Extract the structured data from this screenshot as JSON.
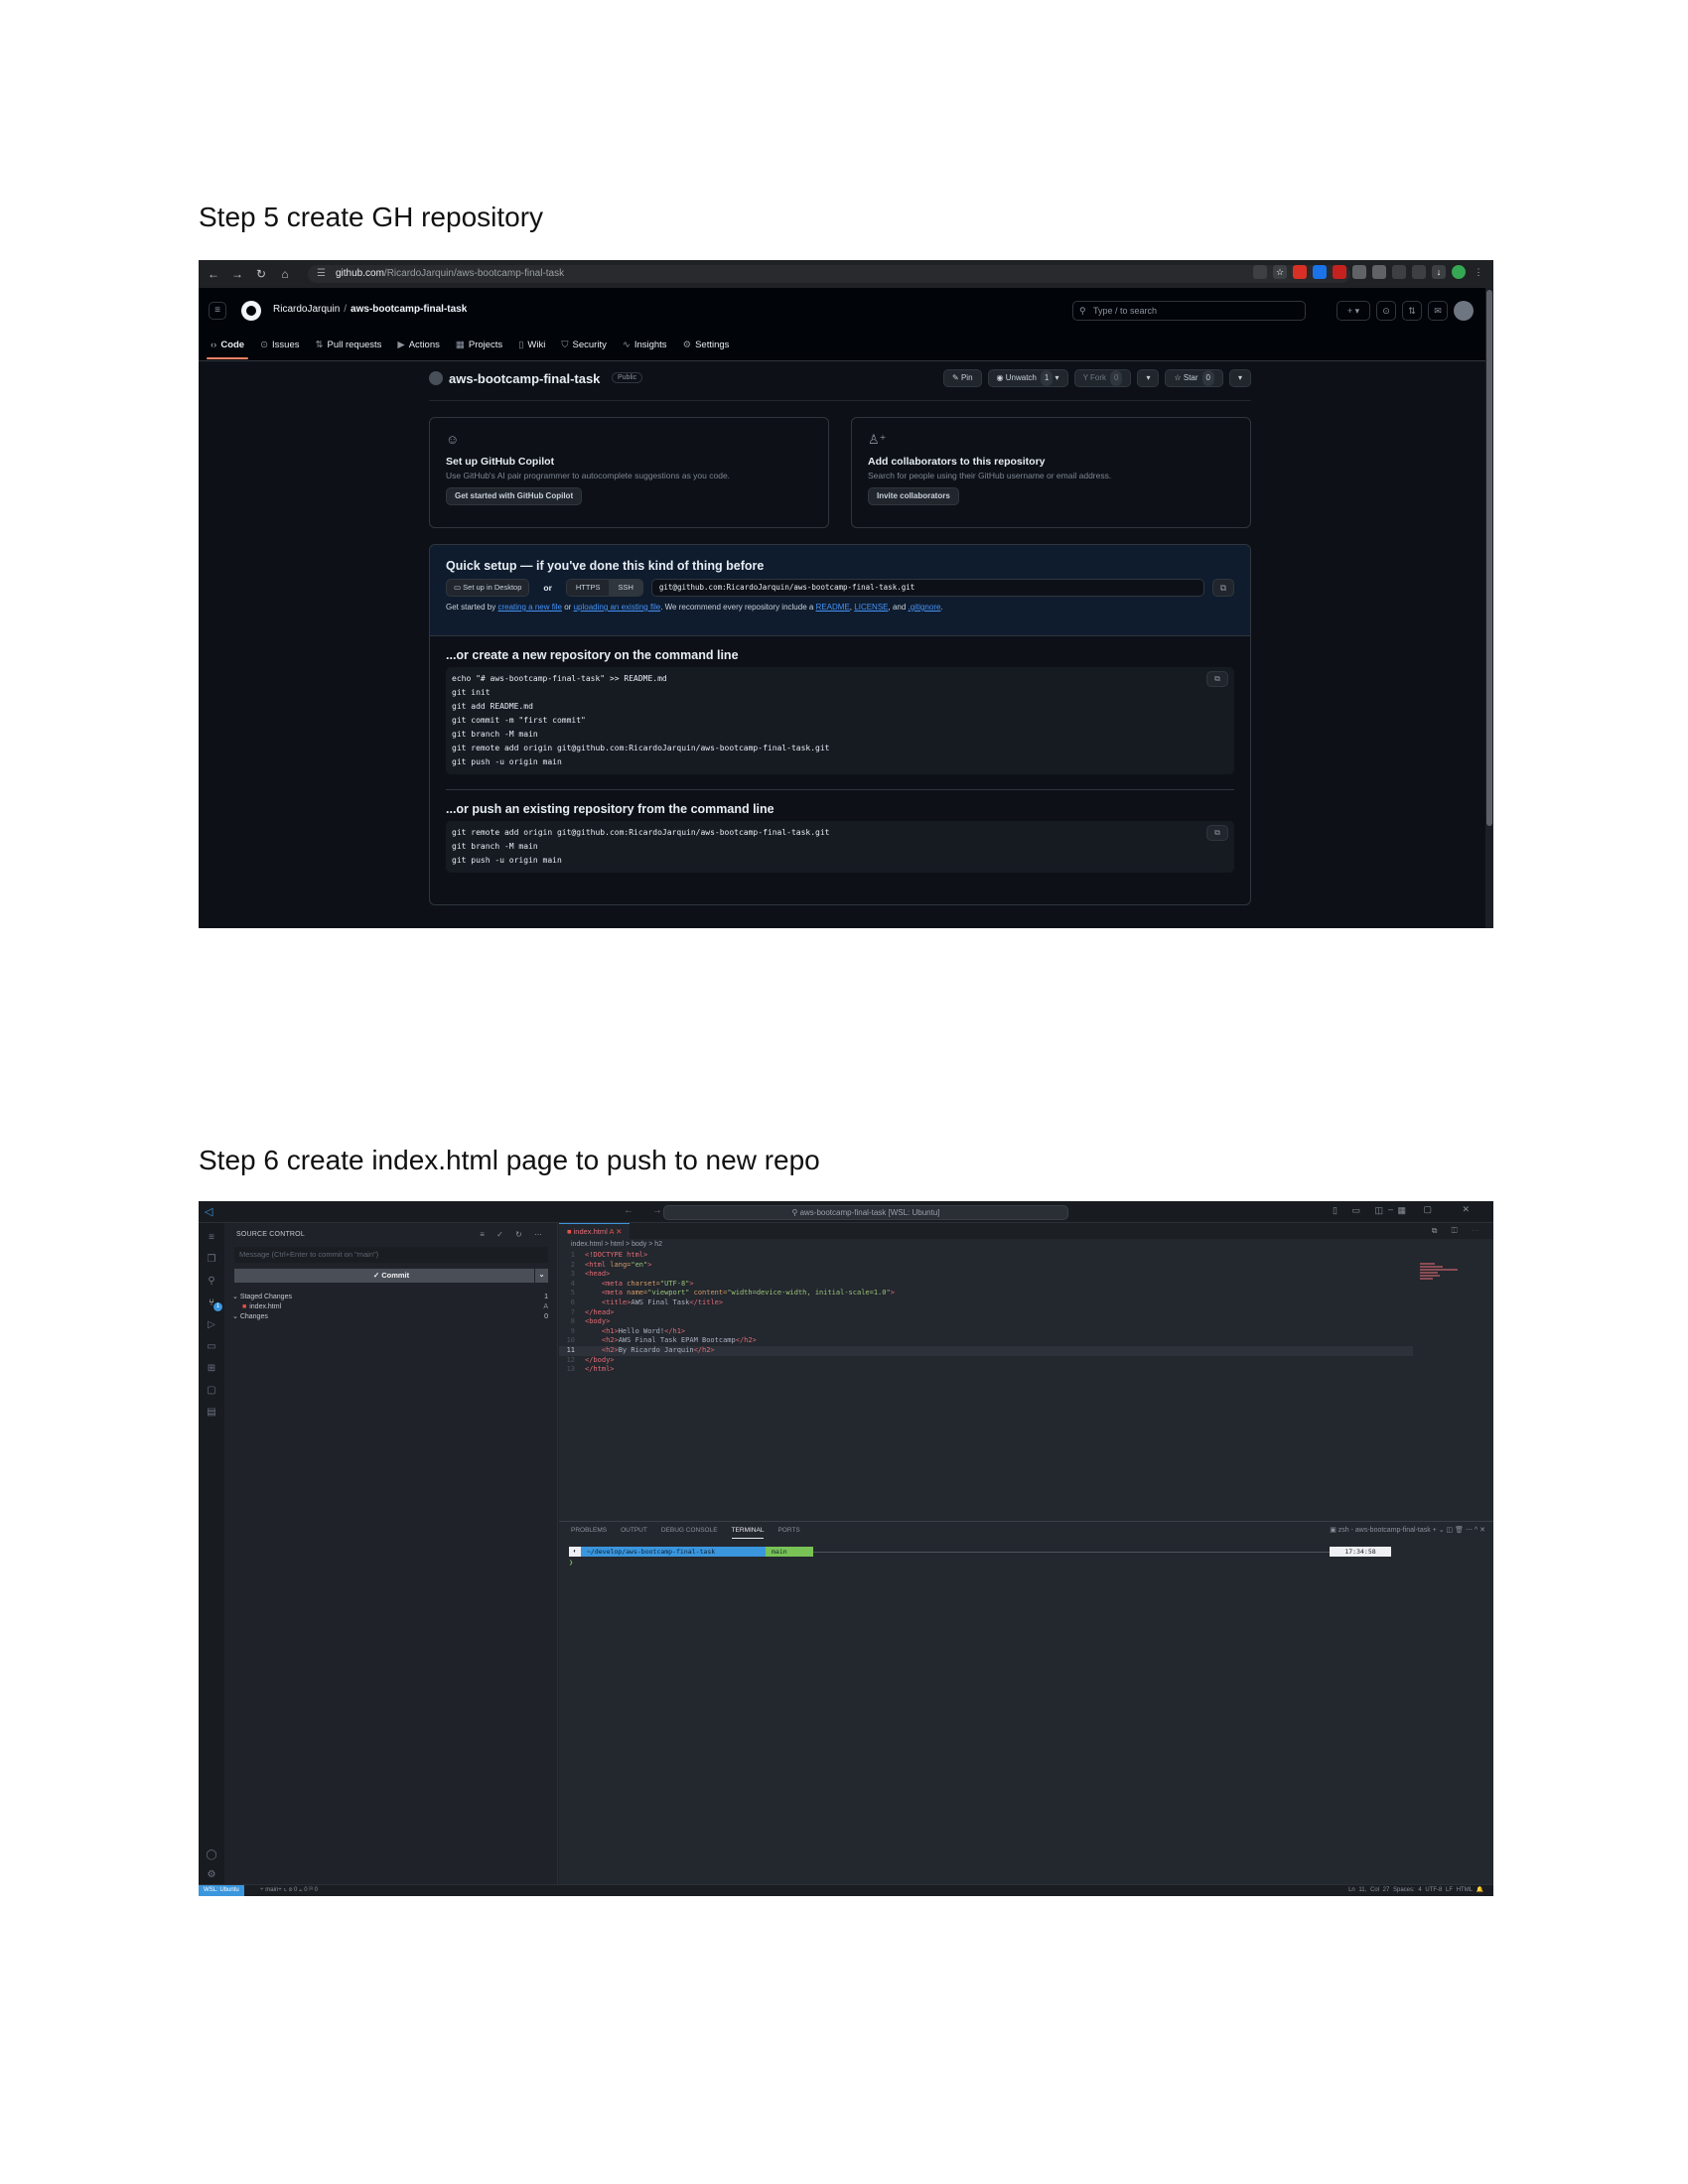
{
  "headings": {
    "step5": "Step 5 create GH repository",
    "step6": "Step 6 create index.html page to push to new repo"
  },
  "github": {
    "browser": {
      "url_host": "github.com",
      "url_path": "/RicardoJarquin/aws-bootcamp-final-task"
    },
    "header": {
      "owner": "RicardoJarquin",
      "separator": "/",
      "repo": "aws-bootcamp-final-task",
      "search_placeholder": "Type / to search"
    },
    "tabs": [
      {
        "label": "Code",
        "icon": "code-icon"
      },
      {
        "label": "Issues",
        "icon": "issue-icon"
      },
      {
        "label": "Pull requests",
        "icon": "pull-request-icon"
      },
      {
        "label": "Actions",
        "icon": "play-icon"
      },
      {
        "label": "Projects",
        "icon": "table-icon"
      },
      {
        "label": "Wiki",
        "icon": "book-icon"
      },
      {
        "label": "Security",
        "icon": "shield-icon"
      },
      {
        "label": "Insights",
        "icon": "graph-icon"
      },
      {
        "label": "Settings",
        "icon": "gear-icon"
      }
    ],
    "repo": {
      "name": "aws-bootcamp-final-task",
      "visibility": "Public",
      "pin": "Pin",
      "unwatch": "Unwatch",
      "unwatch_count": "1",
      "fork": "Fork",
      "fork_count": "0",
      "star": "Star",
      "star_count": "0"
    },
    "cards": {
      "copilot": {
        "title": "Set up GitHub Copilot",
        "desc": "Use GitHub's AI pair programmer to autocomplete suggestions as you code.",
        "button": "Get started with GitHub Copilot"
      },
      "collab": {
        "title": "Add collaborators to this repository",
        "desc": "Search for people using their GitHub username or email address.",
        "button": "Invite collaborators"
      }
    },
    "quick_setup": {
      "title": "Quick setup — if you've done this kind of thing before",
      "desktop": "Set up in Desktop",
      "or": "or",
      "https": "HTTPS",
      "ssh": "SSH",
      "clone_url": "git@github.com:RicardoJarquin/aws-bootcamp-final-task.git",
      "started_prefix": "Get started by",
      "link_new": "creating a new file",
      "or_word": "or",
      "link_upload": "uploading an existing file",
      "recommend": ". We recommend every repository include a",
      "link_readme": "README",
      "comma": ",",
      "link_license": "LICENSE",
      "and": ", and",
      "link_gitignore": ".gitignore",
      "period": "."
    },
    "new_repo": {
      "title": "...or create a new repository on the command line",
      "lines": [
        "echo \"# aws-bootcamp-final-task\" >> README.md",
        "git init",
        "git add README.md",
        "git commit -m \"first commit\"",
        "git branch -M main",
        "git remote add origin git@github.com:RicardoJarquin/aws-bootcamp-final-task.git",
        "git push -u origin main"
      ]
    },
    "push_existing": {
      "title": "...or push an existing repository from the command line",
      "lines": [
        "git remote add origin git@github.com:RicardoJarquin/aws-bootcamp-final-task.git",
        "git branch -M main",
        "git push -u origin main"
      ]
    }
  },
  "vscode": {
    "command_center": "aws-bootcamp-final-task [WSL: Ubuntu]",
    "sidebar": {
      "title": "SOURCE CONTROL",
      "message_placeholder": "Message (Ctrl+Enter to commit on \"main\")",
      "commit_label": "✓ Commit",
      "staged_label": "Staged Changes",
      "staged_count": "1",
      "staged_file": "index.html",
      "staged_file_status": "A",
      "changes_label": "Changes",
      "changes_count": "0",
      "badge": "1"
    },
    "editor": {
      "tab_name": "index.html",
      "tab_status": "A",
      "breadcrumb": "index.html > html > body > h2",
      "code": [
        {
          "n": "1",
          "parts": [
            [
              "tag",
              "<!DOCTYPE html>"
            ]
          ]
        },
        {
          "n": "2",
          "parts": [
            [
              "tag",
              "<html "
            ],
            [
              "attr",
              "lang="
            ],
            [
              "str",
              "\"en\""
            ],
            [
              "tag",
              ">"
            ]
          ]
        },
        {
          "n": "3",
          "parts": [
            [
              "tag",
              "<head>"
            ]
          ]
        },
        {
          "n": "4",
          "parts": [
            [
              "txt",
              "    "
            ],
            [
              "tag",
              "<meta "
            ],
            [
              "attr",
              "charset="
            ],
            [
              "str",
              "\"UTF-8\""
            ],
            [
              "tag",
              ">"
            ]
          ]
        },
        {
          "n": "5",
          "parts": [
            [
              "txt",
              "    "
            ],
            [
              "tag",
              "<meta "
            ],
            [
              "attr",
              "name="
            ],
            [
              "str",
              "\"viewport\""
            ],
            [
              "attr",
              " content="
            ],
            [
              "str",
              "\"width=device-width, initial-scale=1.0\""
            ],
            [
              "tag",
              ">"
            ]
          ]
        },
        {
          "n": "6",
          "parts": [
            [
              "txt",
              "    "
            ],
            [
              "tag",
              "<title>"
            ],
            [
              "txt",
              "AWS Final Task"
            ],
            [
              "tag",
              "</title>"
            ]
          ]
        },
        {
          "n": "7",
          "parts": [
            [
              "tag",
              "</head>"
            ]
          ]
        },
        {
          "n": "8",
          "parts": [
            [
              "tag",
              "<body>"
            ]
          ]
        },
        {
          "n": "9",
          "parts": [
            [
              "txt",
              "    "
            ],
            [
              "tag",
              "<h1>"
            ],
            [
              "txt",
              "Hello Word!"
            ],
            [
              "tag",
              "</h1>"
            ]
          ]
        },
        {
          "n": "10",
          "parts": [
            [
              "txt",
              "    "
            ],
            [
              "tag",
              "<h2>"
            ],
            [
              "txt",
              "AWS Final Task EPAM Bootcamp"
            ],
            [
              "tag",
              "</h2>"
            ]
          ]
        },
        {
          "n": "11",
          "parts": [
            [
              "txt",
              "    "
            ],
            [
              "tag",
              "<h2>"
            ],
            [
              "txt",
              "By Ricardo Jarquin"
            ],
            [
              "tag",
              "</h2>"
            ]
          ]
        },
        {
          "n": "12",
          "parts": [
            [
              "tag",
              "</body>"
            ]
          ]
        },
        {
          "n": "13",
          "parts": [
            [
              "tag",
              "</html>"
            ]
          ]
        }
      ],
      "current_line": "11"
    },
    "panel": {
      "tabs": [
        "PROBLEMS",
        "OUTPUT",
        "DEBUG CONSOLE",
        "TERMINAL",
        "PORTS"
      ],
      "active_tab": "TERMINAL",
      "shell_label": "zsh - aws-bootcamp-final-task",
      "prompt_dir": "~/develop/aws-bootcamp-final-task",
      "prompt_branch": "main",
      "prompt_time": "17:34:58",
      "caret": "❯"
    },
    "status": {
      "remote": "WSL: Ubuntu",
      "branch": "main+",
      "problems": "0 ⚠ 0",
      "ports": "0",
      "position": "Ln 11, Col 27",
      "spaces": "Spaces: 4",
      "encoding": "UTF-8",
      "eol": "LF",
      "language": "HTML"
    }
  }
}
